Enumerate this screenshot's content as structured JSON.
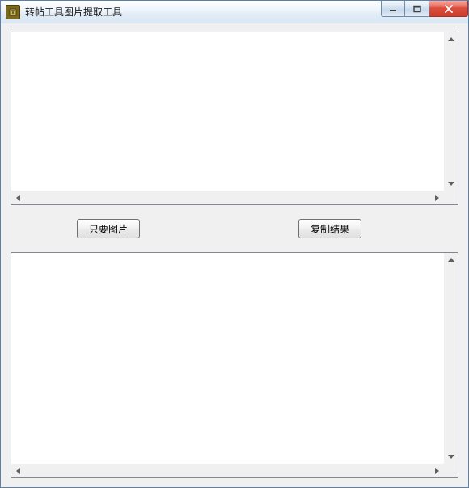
{
  "window": {
    "title": "转帖工具图片提取工具"
  },
  "input": {
    "value": "",
    "placeholder": ""
  },
  "output": {
    "value": "",
    "placeholder": ""
  },
  "buttons": {
    "images_only": "只要图片",
    "copy_result": "复制结果"
  }
}
